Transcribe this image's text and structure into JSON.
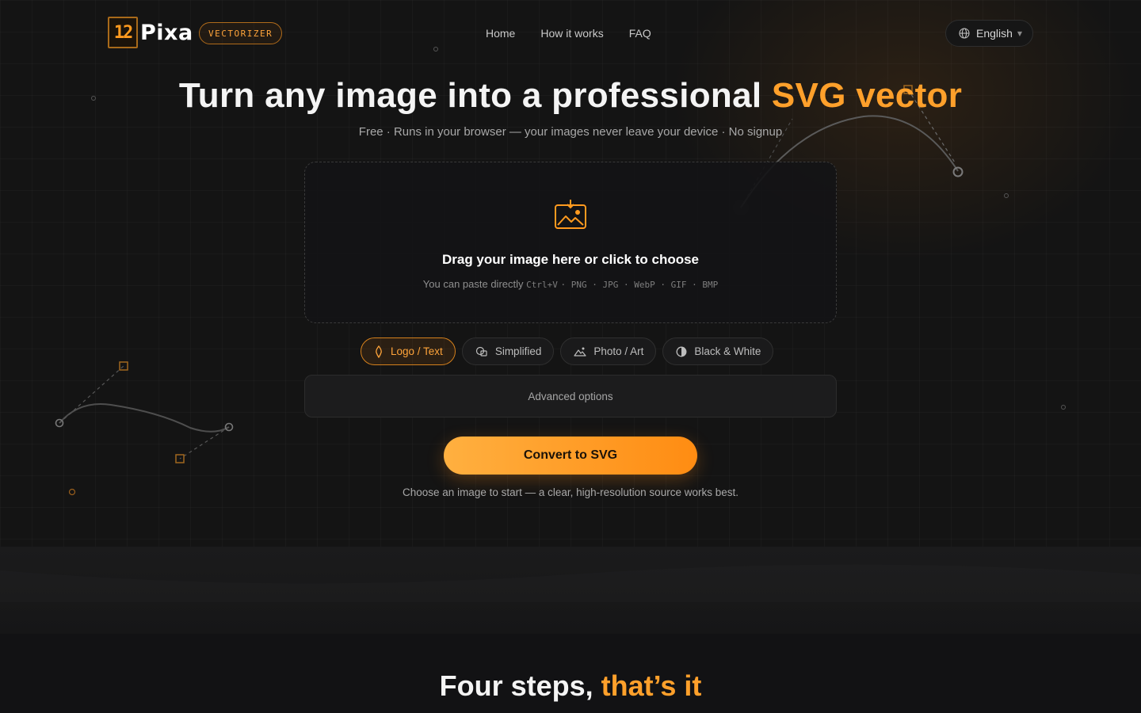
{
  "brand": {
    "logo_mark": "12",
    "logo_word": "Pixa",
    "badge": "VECTORIZER"
  },
  "nav": {
    "items": [
      "Home",
      "How it works",
      "FAQ"
    ]
  },
  "language": {
    "label": "English",
    "icon": "globe-icon"
  },
  "hero": {
    "title_main": "Turn any image into a professional ",
    "title_accent": "SVG vector",
    "subtitle": "Free · Runs in your browser — your images never leave your device · No signup"
  },
  "dropzone": {
    "icon": "image-upload-icon",
    "title": "Drag your image here or click to choose",
    "hint_prefix": "You can paste directly",
    "hint_shortcut": "Ctrl+V",
    "formats": "· PNG · JPG · WebP · GIF · BMP"
  },
  "modes": [
    {
      "label": "Logo / Text",
      "icon": "pen-nib-icon",
      "active": true
    },
    {
      "label": "Simplified",
      "icon": "shapes-icon",
      "active": false
    },
    {
      "label": "Photo / Art",
      "icon": "mountain-icon",
      "active": false
    },
    {
      "label": "Black & White",
      "icon": "contrast-icon",
      "active": false
    }
  ],
  "advanced": {
    "label": "Advanced options"
  },
  "convert": {
    "label": "Convert to SVG",
    "help": "Choose an image to start — a clear, high-resolution source works best."
  },
  "steps": {
    "title_main": "Four steps, ",
    "title_accent": "that’s it"
  },
  "colors": {
    "accent": "#ffa02b",
    "background": "#141414"
  }
}
